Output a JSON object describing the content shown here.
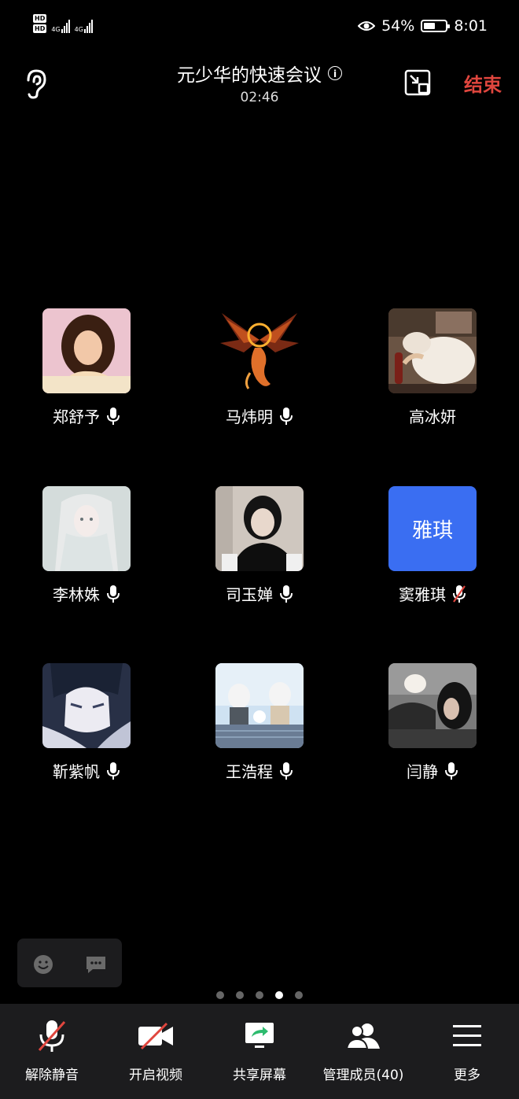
{
  "status_bar": {
    "network_badge": "HD",
    "network_type": "4G",
    "battery": "54%",
    "battery_level": 0.54,
    "time": "8:01"
  },
  "header": {
    "title": "元少华的快速会议",
    "timer": "02:46",
    "end_label": "结束"
  },
  "participants": [
    {
      "name": "郑舒予",
      "mic": "on",
      "avatar_type": "image",
      "avatar_desc": "cartoon-princess-icon",
      "colors": [
        "#e8b8c8",
        "#4a2a1a"
      ]
    },
    {
      "name": "马炜明",
      "mic": "on",
      "avatar_type": "image",
      "avatar_desc": "phoenix-icon",
      "colors": [
        "#000000",
        "#d8602a"
      ]
    },
    {
      "name": "高冰妍",
      "mic": "none",
      "avatar_type": "image",
      "avatar_desc": "dog-photo-icon",
      "colors": [
        "#c8b098",
        "#f0e8e0"
      ]
    },
    {
      "name": "李林姝",
      "mic": "on",
      "avatar_type": "image",
      "avatar_desc": "anime-girl-icon",
      "colors": [
        "#c8d0d0",
        "#e8ece8"
      ]
    },
    {
      "name": "司玉婵",
      "mic": "on",
      "avatar_type": "image",
      "avatar_desc": "girl-photo-icon",
      "colors": [
        "#cfc7bf",
        "#101010"
      ]
    },
    {
      "name": "窦雅琪",
      "mic": "muted",
      "avatar_type": "text",
      "avatar_text": "雅琪",
      "colors": [
        "#3a6ef2",
        "#ffffff"
      ]
    },
    {
      "name": "靳紫帆",
      "mic": "on",
      "avatar_type": "image",
      "avatar_desc": "anime-boy-icon",
      "colors": [
        "#2a3048",
        "#e8e8f0"
      ]
    },
    {
      "name": "王浩程",
      "mic": "on",
      "avatar_type": "image",
      "avatar_desc": "cartoon-scene-icon",
      "colors": [
        "#a8c8e8",
        "#505860"
      ]
    },
    {
      "name": "闫静",
      "mic": "on",
      "avatar_type": "image",
      "avatar_desc": "girl-cat-photo-icon",
      "colors": [
        "#888888",
        "#202020"
      ]
    }
  ],
  "page_dots": {
    "count": 5,
    "active": 4
  },
  "toolbar": [
    {
      "label": "解除静音",
      "icon": "mic-muted-icon"
    },
    {
      "label": "开启视频",
      "icon": "video-off-icon"
    },
    {
      "label": "共享屏幕",
      "icon": "share-screen-icon"
    },
    {
      "label": "管理成员(40)",
      "icon": "members-icon"
    },
    {
      "label": "更多",
      "icon": "menu-icon"
    }
  ],
  "colors": {
    "background": "#000000",
    "toolbar_bg": "#1c1c1e",
    "end_red": "#e0463e",
    "text_avatar_blue": "#3a6ef2",
    "muted_red": "#e0463e"
  }
}
